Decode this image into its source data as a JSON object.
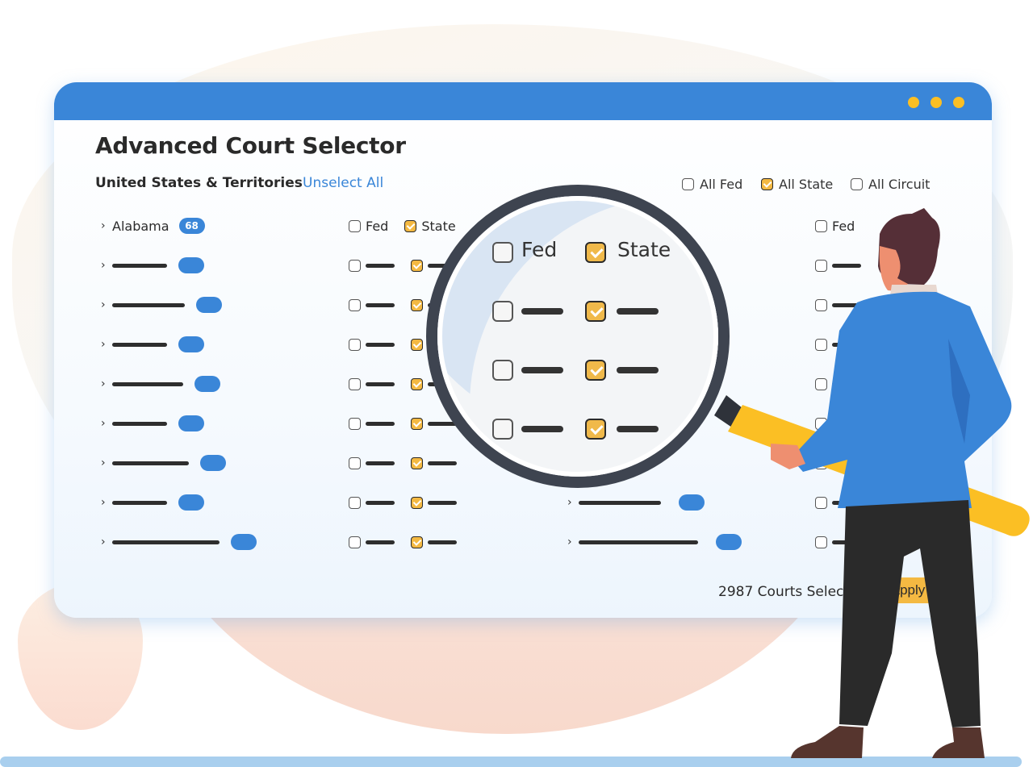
{
  "window": {
    "title": "Advanced Court Selector",
    "region_label": "United States  & Territories",
    "unselect_all": "Unselect All",
    "top_filters": [
      {
        "label": "All Fed",
        "checked": false
      },
      {
        "label": "All State",
        "checked": true
      },
      {
        "label": "All Circuit",
        "checked": false
      }
    ],
    "columns": [
      {
        "first_row": {
          "name": "Alabama",
          "count": "68",
          "fed_label": "Fed",
          "state_label": "State",
          "fed_checked": false,
          "state_checked": true
        }
      }
    ],
    "right_column_header": {
      "fed_label": "Fed"
    },
    "footer": {
      "count_text": "2987 Courts Selected",
      "apply_label": "Apply"
    }
  },
  "magnifier": {
    "fed_label": "Fed",
    "state_label": "State",
    "rows": [
      {
        "fed_checked": false,
        "state_checked": true
      },
      {
        "fed_checked": false,
        "state_checked": true
      },
      {
        "fed_checked": false,
        "state_checked": true
      }
    ]
  },
  "colors": {
    "titlebar": "#3a86d8",
    "accent_blue": "#3a86d8",
    "checkbox_checked": "#f4b942",
    "window_dots": "#fbbf24",
    "apply_button": "#f4b942"
  }
}
